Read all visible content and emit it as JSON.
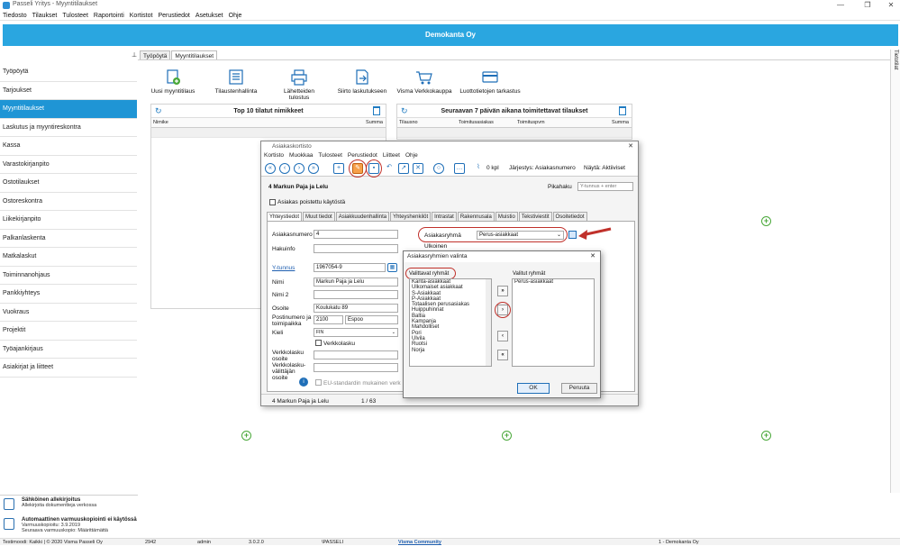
{
  "window": {
    "title": "Passeli Yritys - Myyntitilaukset"
  },
  "menubar": [
    "Tiedosto",
    "Tilaukset",
    "Tulosteet",
    "Raportointi",
    "Kortistot",
    "Perustiedot",
    "Asetukset",
    "Ohje"
  ],
  "banner": {
    "company": "Demokanta Oy"
  },
  "doc_tabs": [
    "Työpöytä",
    "Myyntitilaukset"
  ],
  "right_rail": {
    "label": "Tietotilat"
  },
  "sidebar": {
    "items": [
      {
        "label": "Työpöytä",
        "active": false
      },
      {
        "label": "Tarjoukset",
        "active": false
      },
      {
        "label": "Myyntitilaukset",
        "active": true
      },
      {
        "label": "Laskutus ja myyntireskontra",
        "active": false
      },
      {
        "label": "Kassa",
        "active": false
      },
      {
        "label": "Varastokirjanpito",
        "active": false
      },
      {
        "label": "Ostotilaukset",
        "active": false
      },
      {
        "label": "Ostoreskontra",
        "active": false
      },
      {
        "label": "Liikekirjanpito",
        "active": false
      },
      {
        "label": "Palkanlaskenta",
        "active": false
      },
      {
        "label": "Matkalaskut",
        "active": false
      },
      {
        "label": "Toiminnanohjaus",
        "active": false
      },
      {
        "label": "Pankkiyhteys",
        "active": false
      },
      {
        "label": "Vuokraus",
        "active": false
      },
      {
        "label": "Projektit",
        "active": false
      },
      {
        "label": "Työajankirjaus",
        "active": false
      },
      {
        "label": "Asiakirjat ja liitteet",
        "active": false
      }
    ],
    "bottom": [
      {
        "title": "Sähköinen allekirjoitus",
        "sub1": "Allekirjoita dokumentteja verkossa",
        "sub2": ""
      },
      {
        "title": "Automaattinen varmuuskopiointi ei käytössä",
        "sub1": "Varmuuskopioitu: 3.9.2019",
        "sub2": "Seuraava varmuuskopio: Määrittämättä"
      }
    ]
  },
  "toolbar": [
    {
      "label": "Uusi myyntitilaus",
      "icon": "new-order-icon"
    },
    {
      "label": "Tilaustenhallinta",
      "icon": "list-icon"
    },
    {
      "label": "Lähetteiden tulostus",
      "icon": "printer-icon"
    },
    {
      "label": "Siirto laskutukseen",
      "icon": "transfer-icon"
    },
    {
      "label": "Visma Verkkokauppa",
      "icon": "cart-icon"
    },
    {
      "label": "Luottotietojen tarkastus",
      "icon": "card-icon"
    }
  ],
  "widgets": {
    "left": {
      "title": "Top 10 tilatut nimikkeet",
      "columns": [
        "Nimike",
        "Summa"
      ]
    },
    "right": {
      "title": "Seuraavan 7 päivän aikana toimitettavat tilaukset",
      "columns": [
        "Tilausno",
        "Toimitusasiakas",
        "Toimituspvm",
        "Summa"
      ]
    }
  },
  "dialog": {
    "title": "Asiakaskortisto",
    "close": "✕",
    "menu": [
      "Kortisto",
      "Muokkaa",
      "Tulosteet",
      "Perustiedot",
      "Liitteet",
      "Ohje"
    ],
    "attachments": "0 kpl",
    "sort": "Järjestys: Asiakasnumero",
    "show": "Näytä: Aktiiviset",
    "header_name": "4  Markun Paja ja Lelu",
    "quicksearch_label": "Pikahaku",
    "quicksearch_placeholder": "Y-tunnus + enter",
    "deleted_label": "Asiakas poistettu käytöstä",
    "tabs": [
      "Yhteystiedot",
      "Muut tiedot",
      "Asiakkuudenhallinta",
      "Yhteyshenkilöt",
      "Intrastat",
      "Rakennusala",
      "Muistio",
      "Tekstiviestit",
      "Osoitetiedot"
    ],
    "fields": {
      "asiakasnumero_label": "Asiakasnumero",
      "asiakasnumero": "4",
      "hakuinfo_label": "Hakuinfo",
      "ytunnus_label": "Y-tunnus",
      "ytunnus": "1967054-9",
      "nimi_label": "Nimi",
      "nimi": "Markun Paja ja Lelu",
      "nimi2_label": "Nimi 2",
      "osoite_label": "Osoite",
      "osoite": "Koulukatu 89",
      "postinumero_label": "Postinumero ja toimipaikka",
      "postinumero": "2100",
      "toimipaikka": "Espoo",
      "kieli_label": "Kieli",
      "kieli": "FIN",
      "verkkolasku_label": "Verkkolasku",
      "verkkolasku_osoite_label": "Verkkolasku osoite",
      "valittaja_label": "Verkkolasku-välittäjän osoite",
      "eu_label": "EU-standardin mukainen verk",
      "asiakasryhma_label": "Asiakasryhmä",
      "asiakasryhma": "Perus-asiakkaat",
      "ulkoinen_label": "Ulkoinen"
    },
    "footer_name": "4  Markun Paja ja Lelu",
    "footer_page": "1 / 63"
  },
  "subdialog": {
    "title": "Asiakasryhmien valinta",
    "close": "✕",
    "available_label": "Valittavat ryhmät",
    "selected_label": "Valitut ryhmät",
    "available": [
      "Kanta-asiakkaat",
      "Ulkomaiset asiakkaat",
      "S-Asiakkaat",
      "P-Asiakkaat",
      "Totaalisen perusasiakas",
      "Huippuhinnat",
      "Baltia",
      "Kampanja",
      "Mahdolliset",
      "Pori",
      "Ulvila",
      "Ruotsi",
      "Norja"
    ],
    "selected": [
      "Perus-asiakkaat"
    ],
    "move_all_right": "»",
    "move_right": "›",
    "move_left": "‹",
    "move_all_left": "«",
    "ok": "OK",
    "cancel": "Peruuta"
  },
  "status": {
    "left": "Testimoodi: Kaikki | © 2020 Visma Passeli Oy",
    "num": "2942",
    "user": "admin",
    "version": "3.0.2.0",
    "path": "\\PASSELI",
    "community": "Visma Community",
    "company": "1 - Demokanta Oy"
  },
  "colors": {
    "accent": "#2aa6e0",
    "active": "#1f95d5",
    "highlight": "#c0312b",
    "plus": "#4aa83a"
  }
}
